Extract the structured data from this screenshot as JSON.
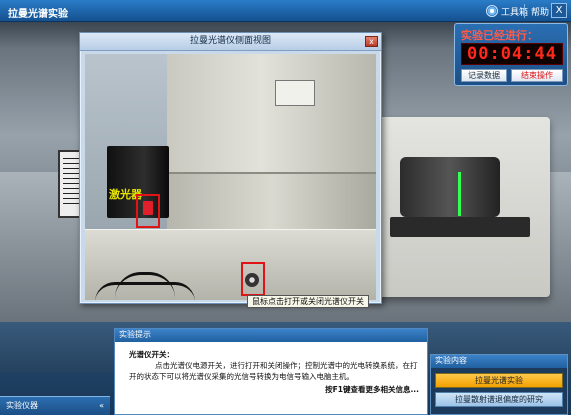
{
  "titlebar": {
    "title": "拉曼光谱实验",
    "toolbox": "工具箱",
    "help": "帮助",
    "close": "X"
  },
  "status": {
    "label": "实验已经进行：",
    "timer": "00:04:44",
    "record_button": "记录数据",
    "end_button": "结束操作"
  },
  "dialog": {
    "title": "拉曼光谱仪侧面视图",
    "close": "x",
    "laser_label": "激光器",
    "tooltip": "鼠标点击打开或关闭光谱仪开关"
  },
  "prompt": {
    "title": "实验提示",
    "heading": "光谱仪开关：",
    "text": "点击光谱仪电源开关，进行打开和关闭操作；控制光谱中的光电转换系统，在打开的状态下可以将光谱仪采集的光信号转换为电信号输入电脑主机。",
    "hint": "按F1键查看更多相关信息..."
  },
  "instruments_panel": {
    "title": "实验仪器",
    "toggle": "«"
  },
  "content_panel": {
    "title": "实验内容",
    "items": [
      "拉曼光谱实验",
      "拉曼散射谱退偏度的研究"
    ]
  }
}
